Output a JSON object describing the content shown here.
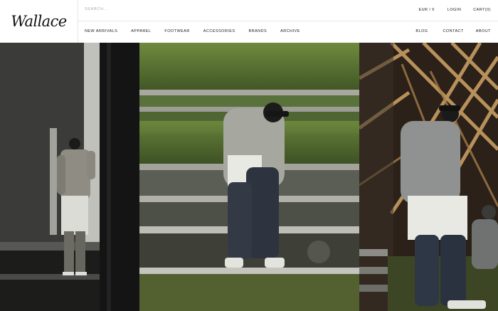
{
  "brand": {
    "logo_text": "Wallace"
  },
  "search": {
    "placeholder": "SEARCH..."
  },
  "top_links": [
    {
      "label": "EUR / €"
    },
    {
      "label": "LOGIN"
    },
    {
      "label": "CART(0)"
    }
  ],
  "nav": {
    "left": [
      {
        "label": "NEW ARRIVALS"
      },
      {
        "label": "APPAREL"
      },
      {
        "label": "FOOTWEAR"
      },
      {
        "label": "ACCESSORIES"
      },
      {
        "label": "BRANDS"
      },
      {
        "label": "ARCHIVE"
      }
    ],
    "right": [
      {
        "label": "BLOG"
      },
      {
        "label": "CONTACT"
      },
      {
        "label": "ABOUT"
      }
    ]
  },
  "colors": {
    "moss": "#5f7a35",
    "concrete": "#9a9a92",
    "wood": "#b08a58",
    "dark": "#1a1a1a"
  },
  "hero": {
    "panels": [
      {
        "name": "hero-photo-left"
      },
      {
        "name": "hero-photo-center"
      },
      {
        "name": "hero-photo-right"
      }
    ]
  }
}
